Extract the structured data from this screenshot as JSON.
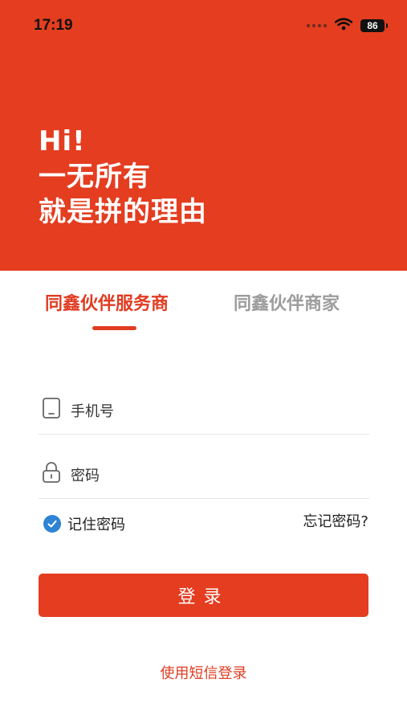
{
  "status": {
    "time": "17:19",
    "battery": "86"
  },
  "hero": {
    "line1": "Hi!",
    "line2": "一无所有",
    "line3": "就是拼的理由"
  },
  "tabs": [
    {
      "label": "同鑫伙伴服务商",
      "active": true
    },
    {
      "label": "同鑫伙伴商家",
      "active": false
    }
  ],
  "form": {
    "phone_placeholder": "手机号",
    "password_placeholder": "密码",
    "remember_label": "记住密码",
    "remember_checked": true,
    "forgot_label": "忘记密码?"
  },
  "login_label": "登录",
  "sms_link": "使用短信登录",
  "icons": {
    "phone": "phone-icon",
    "lock": "lock-icon",
    "wifi": "wifi-icon",
    "check": "check-icon"
  },
  "colors": {
    "brand": "#e43d20",
    "tab_inactive": "#9c9c9c",
    "checkbox": "#2f83d4"
  }
}
